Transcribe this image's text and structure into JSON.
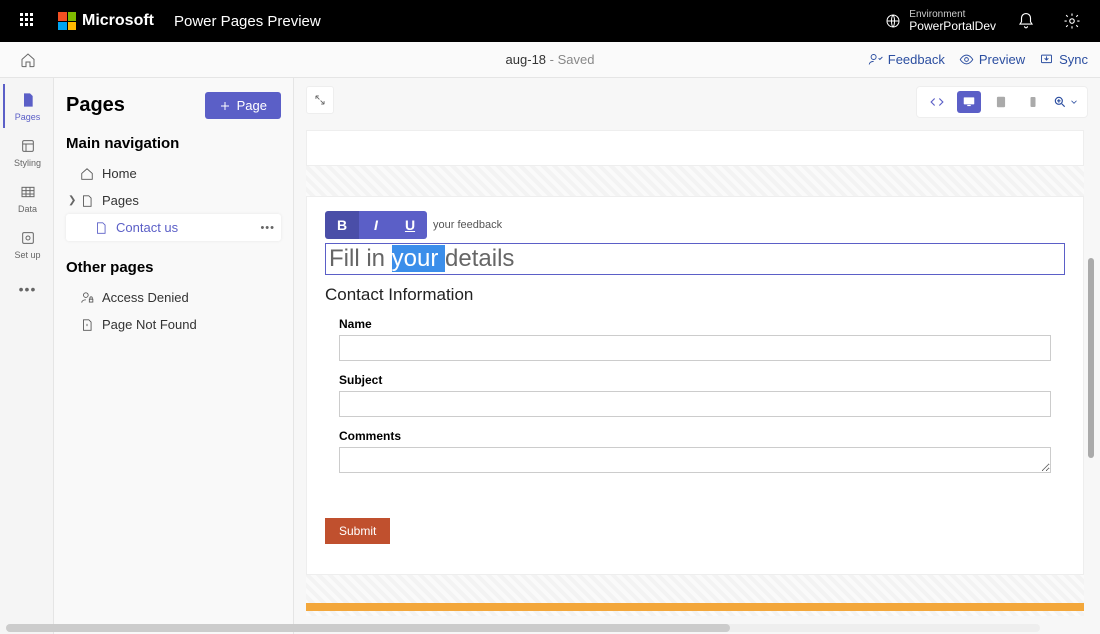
{
  "topbar": {
    "brand": "Microsoft",
    "app": "Power Pages Preview",
    "env_label": "Environment",
    "env_name": "PowerPortalDev"
  },
  "subbar": {
    "doc": "aug-18",
    "status": " - Saved",
    "feedback": "Feedback",
    "preview": "Preview",
    "sync": "Sync"
  },
  "rail": {
    "pages": "Pages",
    "styling": "Styling",
    "data": "Data",
    "setup": "Set up"
  },
  "side": {
    "title": "Pages",
    "add_btn": "Page",
    "nav_section": "Main navigation",
    "other_section": "Other pages",
    "home": "Home",
    "pages": "Pages",
    "contact": "Contact us",
    "access": "Access Denied",
    "notfound": "Page Not Found"
  },
  "editor": {
    "toolbar_hint": "your feedback",
    "heading_pre": "Fill in ",
    "heading_sel": "your ",
    "heading_post": "details",
    "sub": "Contact Information",
    "name_lbl": "Name",
    "subject_lbl": "Subject",
    "comments_lbl": "Comments",
    "submit": "Submit"
  }
}
